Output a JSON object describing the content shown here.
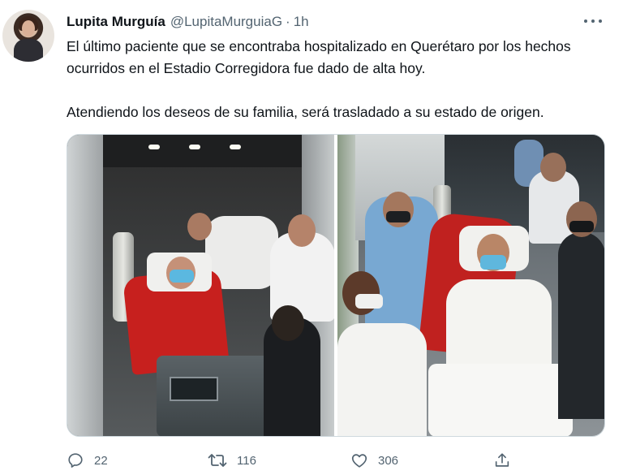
{
  "author": {
    "display_name": "Lupita Murguía",
    "handle": "@LupitaMurguiaG",
    "separator": "·",
    "time": "1h"
  },
  "tweet": {
    "paragraph_1": "El último paciente que se encontraba hospitalizado en Querétaro por los hechos ocurridos en el Estadio Corregidora fue dado de alta hoy.",
    "paragraph_2": "Atendiendo los deseos de su familia, será trasladado a su estado de origen."
  },
  "media": {
    "photos": [
      {
        "id": "photo-1"
      },
      {
        "id": "photo-2"
      }
    ]
  },
  "actions": {
    "reply_count": "22",
    "retweet_count": "116",
    "like_count": "306"
  },
  "icons": {
    "more": "more-horizontal-icon",
    "reply": "reply-icon",
    "retweet": "retweet-icon",
    "like": "heart-icon",
    "share": "share-icon"
  },
  "colors": {
    "text_primary": "#0f1419",
    "text_secondary": "#536471",
    "border": "#cfd9de"
  }
}
